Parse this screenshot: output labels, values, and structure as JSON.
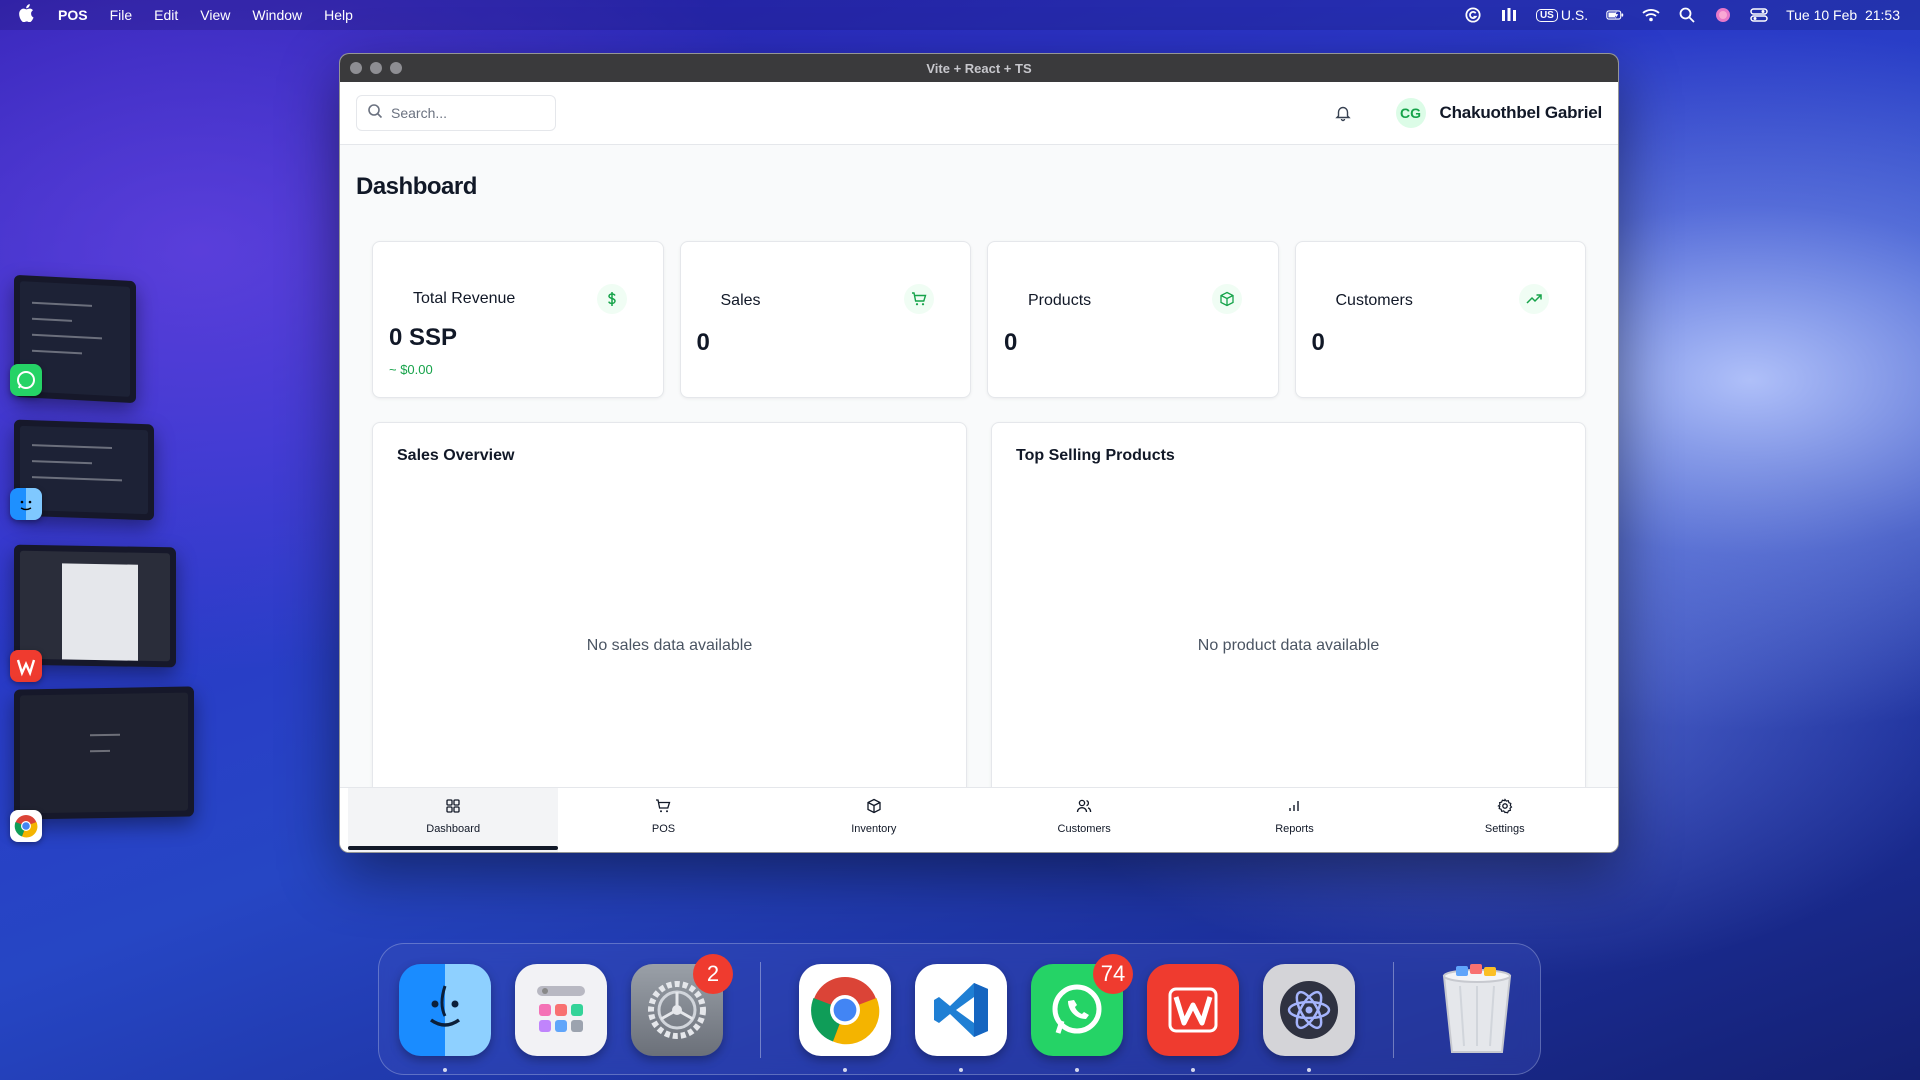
{
  "menubar": {
    "app_name": "POS",
    "menus": [
      "File",
      "Edit",
      "View",
      "Window",
      "Help"
    ],
    "input_source": "U.S.",
    "input_badge": "US",
    "datetime": "Tue 10 Feb  21:53"
  },
  "window": {
    "title": "Vite + React + TS"
  },
  "topbar": {
    "search_placeholder": "Search...",
    "avatar_initials": "CG",
    "user_name": "Chakuothbel Gabriel"
  },
  "page": {
    "title": "Dashboard"
  },
  "stats": [
    {
      "label": "Total Revenue",
      "value": "0 SSP",
      "sub": "~ $0.00",
      "icon": "dollar-icon"
    },
    {
      "label": "Sales",
      "value": "0",
      "icon": "cart-icon"
    },
    {
      "label": "Products",
      "value": "0",
      "icon": "package-icon"
    },
    {
      "label": "Customers",
      "value": "0",
      "icon": "trending-up-icon"
    }
  ],
  "panels": [
    {
      "title": "Sales Overview",
      "empty": "No sales data available"
    },
    {
      "title": "Top Selling Products",
      "empty": "No product data available"
    }
  ],
  "nav": [
    {
      "label": "Dashboard",
      "active": true
    },
    {
      "label": "POS"
    },
    {
      "label": "Inventory"
    },
    {
      "label": "Customers"
    },
    {
      "label": "Reports"
    },
    {
      "label": "Settings"
    }
  ],
  "dock": {
    "settings_badge": "2",
    "whatsapp_badge": "74"
  },
  "colors": {
    "accent_green": "#16a34a",
    "text_dark": "#111827",
    "badge_red": "#ef3b2f"
  }
}
